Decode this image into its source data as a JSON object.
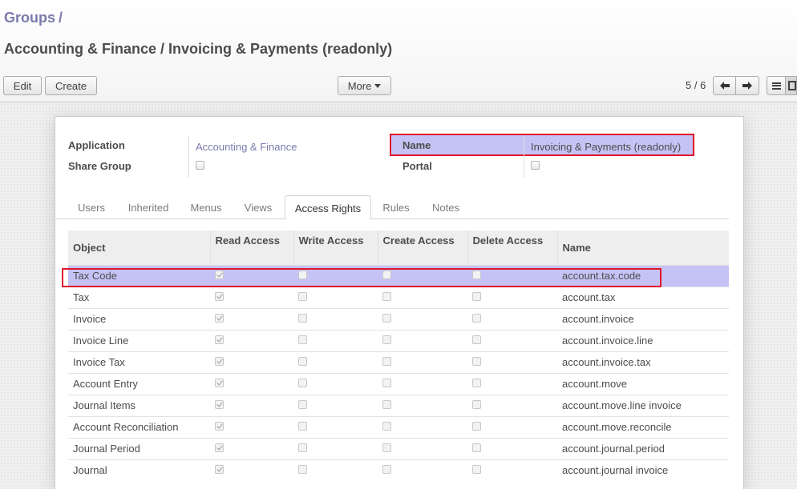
{
  "breadcrumb": {
    "parent": "Groups",
    "separator": "/"
  },
  "record": {
    "title": "Accounting & Finance / Invoicing & Payments (readonly)"
  },
  "toolbar": {
    "edit_label": "Edit",
    "create_label": "Create",
    "more_label": "More"
  },
  "pager": {
    "value": "5 / 6"
  },
  "view_switcher": {
    "list_icon": "list-icon",
    "form_icon": "form-icon"
  },
  "form": {
    "application_label": "Application",
    "application_value": "Accounting & Finance",
    "share_group_label": "Share Group",
    "share_group_checked": false,
    "name_label": "Name",
    "name_value": "Invoicing & Payments (readonly)",
    "portal_label": "Portal",
    "portal_checked": false
  },
  "tabs": [
    {
      "label": "Users"
    },
    {
      "label": "Inherited"
    },
    {
      "label": "Menus"
    },
    {
      "label": "Views"
    },
    {
      "label": "Access Rights",
      "active": true
    },
    {
      "label": "Rules"
    },
    {
      "label": "Notes"
    }
  ],
  "access_table": {
    "columns": [
      "Object",
      "Read Access",
      "Write Access",
      "Create Access",
      "Delete Access",
      "Name"
    ],
    "rows": [
      {
        "object": "Tax Code",
        "read": true,
        "write": false,
        "create": false,
        "delete": false,
        "name": "account.tax.code",
        "selected": true
      },
      {
        "object": "Tax",
        "read": true,
        "write": false,
        "create": false,
        "delete": false,
        "name": "account.tax"
      },
      {
        "object": "Invoice",
        "read": true,
        "write": false,
        "create": false,
        "delete": false,
        "name": "account.invoice"
      },
      {
        "object": "Invoice Line",
        "read": true,
        "write": false,
        "create": false,
        "delete": false,
        "name": "account.invoice.line"
      },
      {
        "object": "Invoice Tax",
        "read": true,
        "write": false,
        "create": false,
        "delete": false,
        "name": "account.invoice.tax"
      },
      {
        "object": "Account Entry",
        "read": true,
        "write": false,
        "create": false,
        "delete": false,
        "name": "account.move"
      },
      {
        "object": "Journal Items",
        "read": true,
        "write": false,
        "create": false,
        "delete": false,
        "name": "account.move.line invoice"
      },
      {
        "object": "Account Reconciliation",
        "read": true,
        "write": false,
        "create": false,
        "delete": false,
        "name": "account.move.reconcile"
      },
      {
        "object": "Journal Period",
        "read": true,
        "write": false,
        "create": false,
        "delete": false,
        "name": "account.journal.period"
      },
      {
        "object": "Journal",
        "read": true,
        "write": false,
        "create": false,
        "delete": false,
        "name": "account.journal invoice"
      }
    ]
  },
  "colors": {
    "link": "#7c7bad",
    "highlight": "#c5c3f5",
    "annotation_border": "#e1142a"
  }
}
